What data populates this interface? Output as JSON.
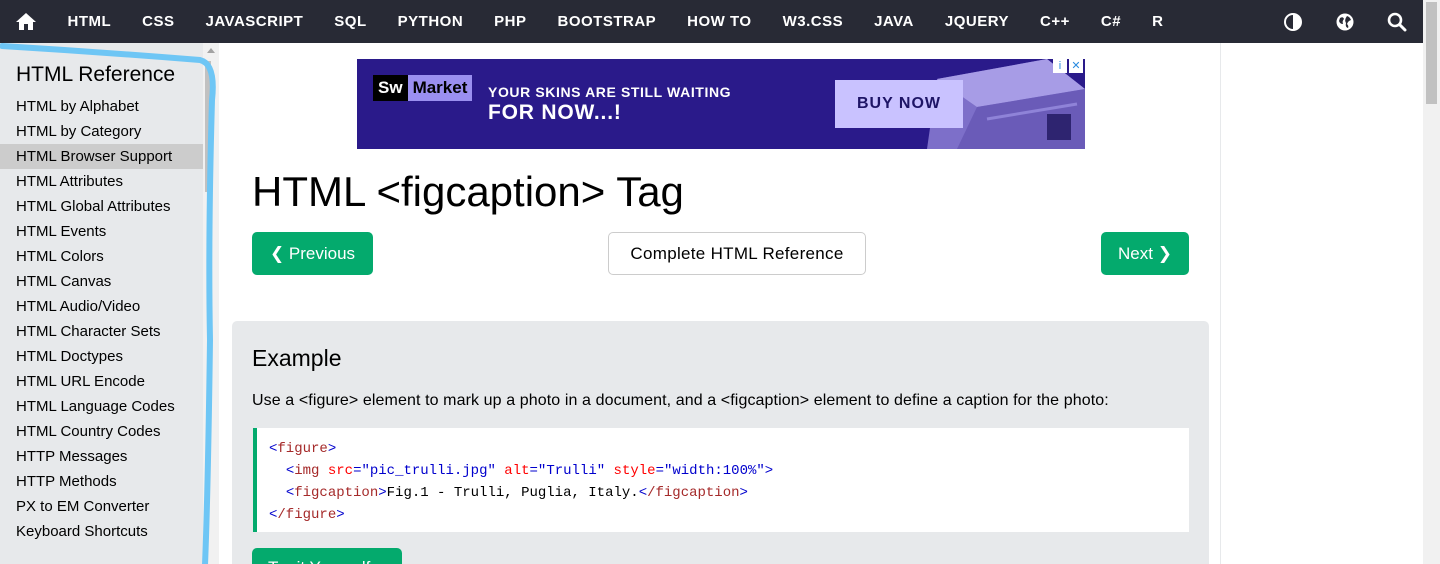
{
  "nav": {
    "items": [
      "HTML",
      "CSS",
      "JAVASCRIPT",
      "SQL",
      "PYTHON",
      "PHP",
      "BOOTSTRAP",
      "HOW TO",
      "W3.CSS",
      "JAVA",
      "JQUERY",
      "C++",
      "C#",
      "R"
    ],
    "icons": [
      "home-icon",
      "contrast-icon",
      "globe-icon",
      "search-icon"
    ],
    "background": "#282a35"
  },
  "sidebar": {
    "title": "HTML Reference",
    "items": [
      {
        "label": "HTML by Alphabet"
      },
      {
        "label": "HTML by Category"
      },
      {
        "label": "HTML Browser Support",
        "active": true
      },
      {
        "label": "HTML Attributes"
      },
      {
        "label": "HTML Global Attributes"
      },
      {
        "label": "HTML Events"
      },
      {
        "label": "HTML Colors"
      },
      {
        "label": "HTML Canvas"
      },
      {
        "label": "HTML Audio/Video"
      },
      {
        "label": "HTML Character Sets"
      },
      {
        "label": "HTML Doctypes"
      },
      {
        "label": "HTML URL Encode"
      },
      {
        "label": "HTML Language Codes"
      },
      {
        "label": "HTML Country Codes"
      },
      {
        "label": "HTTP Messages"
      },
      {
        "label": "HTTP Methods"
      },
      {
        "label": "PX to EM Converter"
      },
      {
        "label": "Keyboard Shortcuts"
      }
    ]
  },
  "ad": {
    "brand_sw": "Sw",
    "brand_market": "Market",
    "line1": "YOUR SKINS ARE STILL WAITING",
    "line2": "FOR NOW...!",
    "cta": "BUY NOW",
    "info_glyph": "i",
    "close_glyph": "✕"
  },
  "main": {
    "title": "HTML <figcaption> Tag",
    "prev_label": "❮ Previous",
    "ref_label": "Complete HTML Reference",
    "next_label": "Next ❯",
    "accent": "#04aa6d"
  },
  "example": {
    "heading": "Example",
    "description": "Use a <figure> element to mark up a photo in a document, and a <figcaption> element to define a caption for the photo:",
    "code": {
      "l1_tag": "figure",
      "l2_tag": "img",
      "l2_attr1": "src",
      "l2_val1": "\"pic_trulli.jpg\"",
      "l2_attr2": "alt",
      "l2_val2": "\"Trulli\"",
      "l2_attr3": "style",
      "l2_val3": "\"width:100%\"",
      "l3_tag": "figcaption",
      "l3_text": "Fig.1 - Trulli, Puglia, Italy.",
      "l3_close": "/figcaption",
      "l4_close": "/figure"
    },
    "try_label": "Try it Yourself »"
  }
}
